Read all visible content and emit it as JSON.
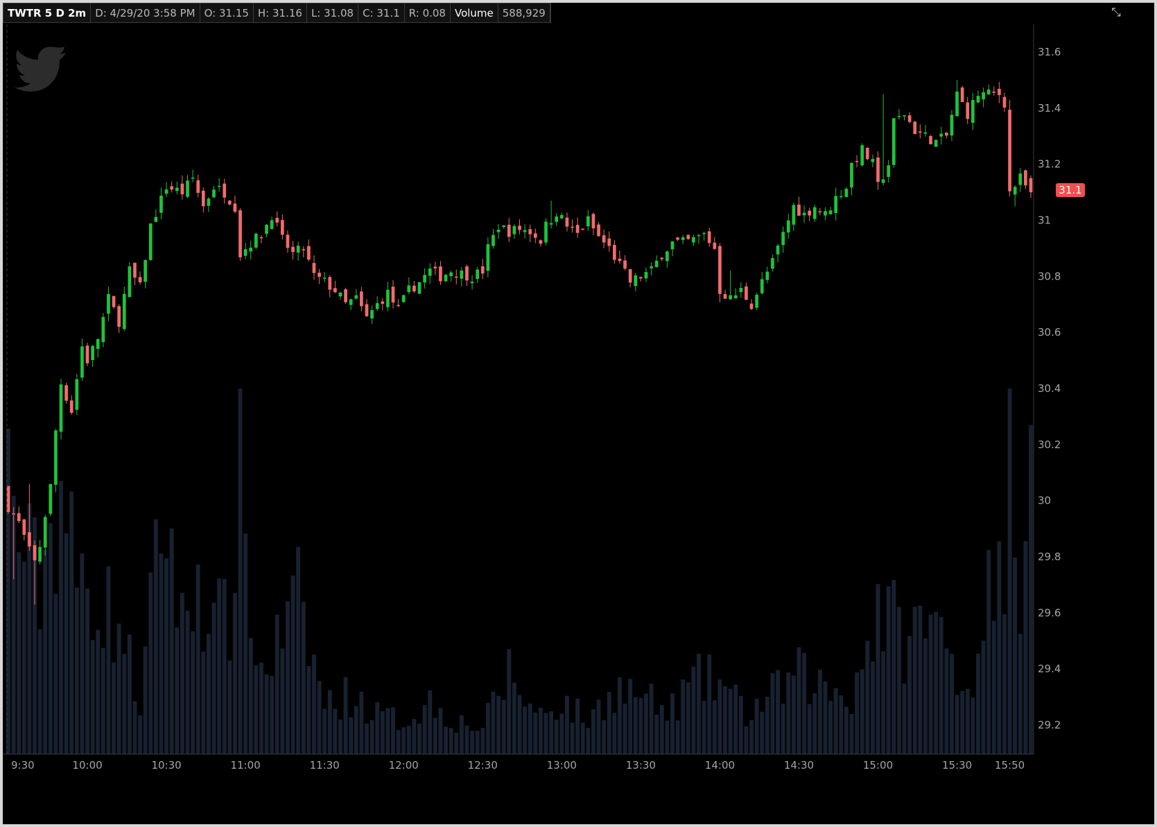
{
  "header": {
    "symbol": "TWTR 5 D 2m",
    "date": "D: 4/29/20 3:58 PM",
    "open": "O: 31.15",
    "high": "H: 31.16",
    "low": "L: 31.08",
    "close": "C: 31.1",
    "range": "R: 0.08",
    "volume_label": "Volume",
    "volume_value": "588,929"
  },
  "icons": {
    "logo": "twitter-bird-icon",
    "menu": "expand-collapse-icon"
  },
  "price_axis": {
    "ticks": [
      "31.6",
      "31.4",
      "31.2",
      "31",
      "30.8",
      "30.6",
      "30.4",
      "30.2",
      "30",
      "29.8",
      "29.6",
      "29.4",
      "29.2"
    ],
    "last_price_label": "31.1",
    "last_price": 31.1
  },
  "time_axis": {
    "ticks": [
      "9:30",
      "10:00",
      "10:30",
      "11:00",
      "11:30",
      "12:00",
      "12:30",
      "13:00",
      "13:30",
      "14:00",
      "14:30",
      "15:00",
      "15:30",
      "15:50"
    ]
  },
  "colors": {
    "up": "#1fc33a",
    "down": "#f26b6b",
    "volume": "#182130",
    "background": "#000000",
    "axis_text": "#a5a5a5",
    "badge": "#f05050"
  },
  "chart_data": {
    "type": "candlestick",
    "symbol": "TWTR",
    "interval": "2m",
    "y_min": 29.1,
    "y_max": 31.7,
    "x_start": "9:30",
    "x_end": "15:58",
    "close_anchors": [
      [
        "9:30",
        29.98
      ],
      [
        "9:34",
        29.92
      ],
      [
        "9:38",
        29.82
      ],
      [
        "9:40",
        29.78
      ],
      [
        "9:42",
        29.84
      ],
      [
        "9:44",
        29.95
      ],
      [
        "9:46",
        30.05
      ],
      [
        "9:48",
        30.25
      ],
      [
        "9:50",
        30.42
      ],
      [
        "9:54",
        30.32
      ],
      [
        "9:58",
        30.55
      ],
      [
        "10:00",
        30.5
      ],
      [
        "10:04",
        30.58
      ],
      [
        "10:08",
        30.72
      ],
      [
        "10:12",
        30.64
      ],
      [
        "10:16",
        30.82
      ],
      [
        "10:20",
        30.76
      ],
      [
        "10:24",
        30.98
      ],
      [
        "10:30",
        31.12
      ],
      [
        "10:36",
        31.1
      ],
      [
        "10:40",
        31.15
      ],
      [
        "10:44",
        31.05
      ],
      [
        "10:48",
        31.12
      ],
      [
        "10:52",
        31.1
      ],
      [
        "10:56",
        31.05
      ],
      [
        "10:58",
        30.88
      ],
      [
        "11:02",
        30.92
      ],
      [
        "11:06",
        30.95
      ],
      [
        "11:10",
        31.02
      ],
      [
        "11:14",
        30.93
      ],
      [
        "11:18",
        30.88
      ],
      [
        "11:22",
        30.9
      ],
      [
        "11:26",
        30.8
      ],
      [
        "11:30",
        30.78
      ],
      [
        "11:34",
        30.75
      ],
      [
        "11:38",
        30.7
      ],
      [
        "11:42",
        30.72
      ],
      [
        "11:46",
        30.65
      ],
      [
        "11:50",
        30.7
      ],
      [
        "11:54",
        30.74
      ],
      [
        "11:58",
        30.68
      ],
      [
        "12:02",
        30.75
      ],
      [
        "12:06",
        30.78
      ],
      [
        "12:10",
        30.82
      ],
      [
        "12:14",
        30.8
      ],
      [
        "12:18",
        30.82
      ],
      [
        "12:22",
        30.81
      ],
      [
        "12:26",
        30.8
      ],
      [
        "12:30",
        30.82
      ],
      [
        "12:32",
        30.9
      ],
      [
        "12:36",
        30.98
      ],
      [
        "12:40",
        30.96
      ],
      [
        "12:44",
        30.97
      ],
      [
        "12:48",
        30.96
      ],
      [
        "12:52",
        30.93
      ],
      [
        "12:54",
        30.98
      ],
      [
        "12:58",
        31.03
      ],
      [
        "13:02",
        30.98
      ],
      [
        "13:06",
        30.95
      ],
      [
        "13:10",
        31
      ],
      [
        "13:14",
        30.94
      ],
      [
        "13:18",
        30.9
      ],
      [
        "13:22",
        30.84
      ],
      [
        "13:26",
        30.78
      ],
      [
        "13:30",
        30.8
      ],
      [
        "13:34",
        30.82
      ],
      [
        "13:38",
        30.88
      ],
      [
        "13:42",
        30.92
      ],
      [
        "13:46",
        30.92
      ],
      [
        "13:50",
        30.93
      ],
      [
        "13:54",
        30.95
      ],
      [
        "13:58",
        30.9
      ],
      [
        "14:00",
        30.75
      ],
      [
        "14:04",
        30.72
      ],
      [
        "14:08",
        30.75
      ],
      [
        "14:12",
        30.7
      ],
      [
        "14:16",
        30.78
      ],
      [
        "14:20",
        30.85
      ],
      [
        "14:24",
        30.95
      ],
      [
        "14:28",
        31.05
      ],
      [
        "14:32",
        31.02
      ],
      [
        "14:36",
        31.05
      ],
      [
        "14:40",
        31.02
      ],
      [
        "14:44",
        31.08
      ],
      [
        "14:48",
        31.12
      ],
      [
        "14:50",
        31.2
      ],
      [
        "14:54",
        31.25
      ],
      [
        "14:58",
        31.2
      ],
      [
        "15:00",
        31.12
      ],
      [
        "15:04",
        31.2
      ],
      [
        "15:06",
        31.35
      ],
      [
        "15:10",
        31.38
      ],
      [
        "15:14",
        31.32
      ],
      [
        "15:18",
        31.3
      ],
      [
        "15:22",
        31.28
      ],
      [
        "15:26",
        31.3
      ],
      [
        "15:30",
        31.45
      ],
      [
        "15:34",
        31.38
      ],
      [
        "15:38",
        31.45
      ],
      [
        "15:42",
        31.45
      ],
      [
        "15:46",
        31.45
      ],
      [
        "15:48",
        31.42
      ],
      [
        "15:50",
        31.1
      ],
      [
        "15:54",
        31.15
      ],
      [
        "15:56",
        31.12
      ],
      [
        "15:58",
        31.1
      ]
    ],
    "high_points": [
      [
        "9:30",
        30.05
      ],
      [
        "9:38",
        30.06
      ],
      [
        "10:36",
        31.16
      ],
      [
        "12:56",
        31.07
      ],
      [
        "14:04",
        30.82
      ],
      [
        "15:02",
        31.45
      ],
      [
        "15:30",
        31.5
      ],
      [
        "15:50",
        31.43
      ]
    ],
    "low_points": [
      [
        "9:32",
        29.72
      ],
      [
        "9:40",
        29.63
      ],
      [
        "11:48",
        30.63
      ],
      [
        "14:14",
        30.68
      ],
      [
        "15:52",
        31.05
      ]
    ],
    "last_bar": {
      "time": "3:58 PM",
      "open": 31.15,
      "high": 31.16,
      "low": 31.08,
      "close": 31.1,
      "range": 0.08,
      "volume": 588929
    },
    "volume_profile": [
      [
        "9:30",
        0.84
      ],
      [
        "9:36",
        0.6
      ],
      [
        "9:42",
        0.52
      ],
      [
        "9:50",
        0.82
      ],
      [
        "9:56",
        0.5
      ],
      [
        "10:00",
        0.55
      ],
      [
        "10:06",
        0.45
      ],
      [
        "10:12",
        0.4
      ],
      [
        "10:20",
        0.15
      ],
      [
        "10:26",
        0.55
      ],
      [
        "10:30",
        0.75
      ],
      [
        "10:36",
        0.38
      ],
      [
        "10:42",
        0.55
      ],
      [
        "10:48",
        0.38
      ],
      [
        "10:54",
        0.42
      ],
      [
        "10:58",
        0.95
      ],
      [
        "11:04",
        0.25
      ],
      [
        "11:10",
        0.3
      ],
      [
        "11:20",
        0.46
      ],
      [
        "11:30",
        0.15
      ],
      [
        "11:40",
        0.18
      ],
      [
        "11:50",
        0.12
      ],
      [
        "12:00",
        0.1
      ],
      [
        "12:10",
        0.16
      ],
      [
        "12:20",
        0.1
      ],
      [
        "12:30",
        0.08
      ],
      [
        "12:40",
        0.25
      ],
      [
        "12:50",
        0.12
      ],
      [
        "13:00",
        0.16
      ],
      [
        "13:10",
        0.1
      ],
      [
        "13:20",
        0.2
      ],
      [
        "13:30",
        0.18
      ],
      [
        "13:40",
        0.12
      ],
      [
        "13:50",
        0.22
      ],
      [
        "14:00",
        0.22
      ],
      [
        "14:10",
        0.12
      ],
      [
        "14:20",
        0.18
      ],
      [
        "14:30",
        0.24
      ],
      [
        "14:40",
        0.2
      ],
      [
        "14:50",
        0.18
      ],
      [
        "15:00",
        0.45
      ],
      [
        "15:10",
        0.35
      ],
      [
        "15:20",
        0.4
      ],
      [
        "15:30",
        0.28
      ],
      [
        "15:36",
        0.18
      ],
      [
        "15:40",
        0.55
      ],
      [
        "15:44",
        0.4
      ],
      [
        "15:48",
        0.6
      ],
      [
        "15:50",
        1
      ],
      [
        "15:52",
        0.92
      ],
      [
        "15:54",
        0.55
      ],
      [
        "15:58",
        0.9
      ]
    ]
  }
}
